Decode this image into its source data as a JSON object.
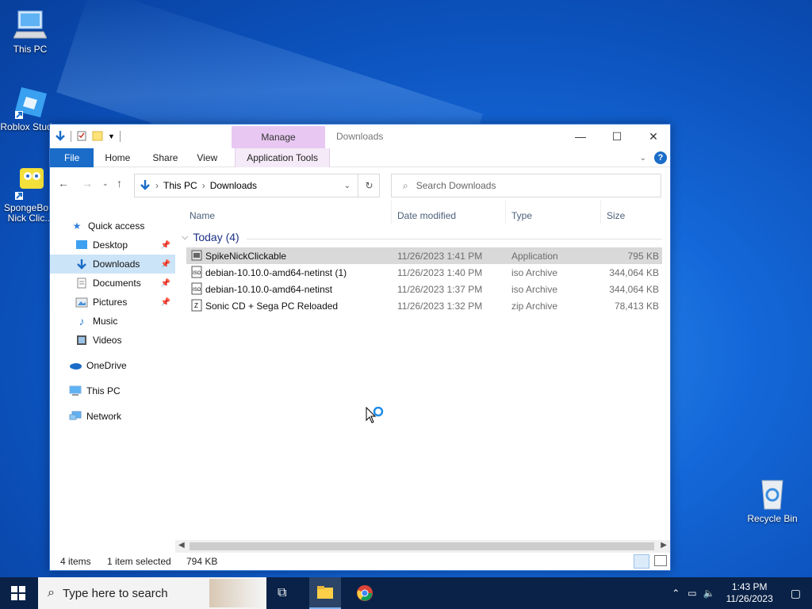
{
  "desktop": {
    "icons": [
      {
        "label": "This PC"
      },
      {
        "label": "Roblox Stud..."
      },
      {
        "label": "SpongeBo... Nick Clic..."
      },
      {
        "label": "Recycle Bin"
      }
    ]
  },
  "window": {
    "title": "Downloads",
    "manage_label": "Manage",
    "ribbon_tabs": [
      "File",
      "Home",
      "Share",
      "View",
      "Application Tools"
    ],
    "breadcrumb": [
      "This PC",
      "Downloads"
    ],
    "search_placeholder": "Search Downloads",
    "nav": {
      "quick_access": "Quick access",
      "items": [
        "Desktop",
        "Downloads",
        "Documents",
        "Pictures",
        "Music",
        "Videos"
      ],
      "onedrive": "OneDrive",
      "this_pc": "This PC",
      "network": "Network"
    },
    "columns": [
      "Name",
      "Date modified",
      "Type",
      "Size"
    ],
    "group_label": "Today (4)",
    "files": [
      {
        "name": "SpikeNickClickable",
        "date": "11/26/2023 1:41 PM",
        "type": "Application",
        "size": "795 KB"
      },
      {
        "name": "debian-10.10.0-amd64-netinst (1)",
        "date": "11/26/2023 1:40 PM",
        "type": "iso Archive",
        "size": "344,064 KB"
      },
      {
        "name": "debian-10.10.0-amd64-netinst",
        "date": "11/26/2023 1:37 PM",
        "type": "iso Archive",
        "size": "344,064 KB"
      },
      {
        "name": "Sonic CD + Sega PC Reloaded",
        "date": "11/26/2023 1:32 PM",
        "type": "zip Archive",
        "size": "78,413 KB"
      }
    ],
    "status": {
      "items": "4 items",
      "selected": "1 item selected",
      "size": "794 KB"
    }
  },
  "taskbar": {
    "search_placeholder": "Type here to search",
    "time": "1:43 PM",
    "date": "11/26/2023"
  },
  "colors": {
    "accent": "#1a6cc8",
    "manage_tab": "#e8c8f2",
    "taskbar": "#0a2247"
  }
}
